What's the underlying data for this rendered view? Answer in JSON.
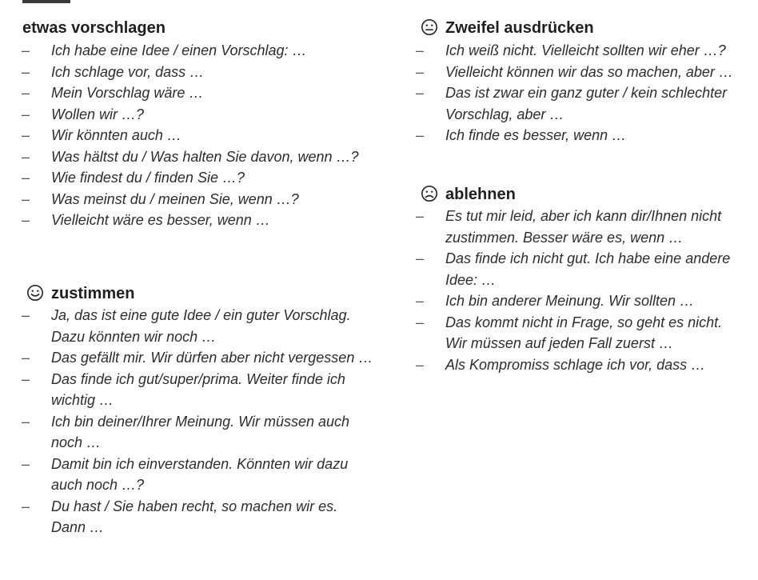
{
  "sections": {
    "vorschlagen": {
      "title": "etwas vorschlagen",
      "items": [
        "Ich habe eine Idee / einen Vorschlag: …",
        "Ich schlage vor, dass …",
        "Mein Vorschlag wäre …",
        "Wollen wir …?",
        "Wir könnten auch …",
        "Was hältst du / Was halten Sie davon, wenn …?",
        "Wie findest du / finden Sie …?",
        "Was meinst du / meinen Sie, wenn …?",
        "Vielleicht wäre es besser, wenn …"
      ]
    },
    "zustimmen": {
      "title": "zustimmen",
      "icon": "happy-face-icon",
      "items": [
        [
          "Ja, das ist eine gute Idee / ein guter Vorschlag.",
          "Dazu könnten wir noch …"
        ],
        [
          "Das gefällt mir. Wir dürfen aber nicht vergessen …"
        ],
        [
          "Das finde ich gut/super/prima. Weiter finde ich",
          "wichtig …"
        ],
        [
          "Ich bin deiner/Ihrer Meinung. Wir müssen auch",
          "noch …"
        ],
        [
          "Damit bin ich einverstanden. Könnten wir dazu",
          "auch noch …?"
        ],
        [
          "Du hast / Sie haben recht, so machen wir es.",
          "Dann …"
        ]
      ]
    },
    "zweifel": {
      "title": "Zweifel ausdrücken",
      "icon": "neutral-face-icon",
      "items": [
        [
          "Ich weiß nicht. Vielleicht sollten wir eher …?"
        ],
        [
          "Vielleicht können wir das so machen, aber …"
        ],
        [
          "Das ist zwar ein ganz guter / kein schlechter",
          "Vorschlag, aber …"
        ],
        [
          "Ich finde es besser, wenn …"
        ]
      ]
    },
    "ablehnen": {
      "title": "ablehnen",
      "icon": "sad-face-icon",
      "items": [
        [
          "Es tut mir leid, aber ich kann dir/Ihnen nicht",
          "zustimmen. Besser wäre es, wenn …"
        ],
        [
          "Das finde ich nicht gut. Ich habe eine andere",
          "Idee: …"
        ],
        [
          "Ich bin anderer Meinung. Wir sollten …"
        ],
        [
          "Das kommt nicht in Frage, so geht es nicht.",
          "Wir müssen auf jeden Fall zuerst …"
        ],
        [
          "Als Kompromiss schlage ich vor, dass …"
        ]
      ]
    }
  }
}
